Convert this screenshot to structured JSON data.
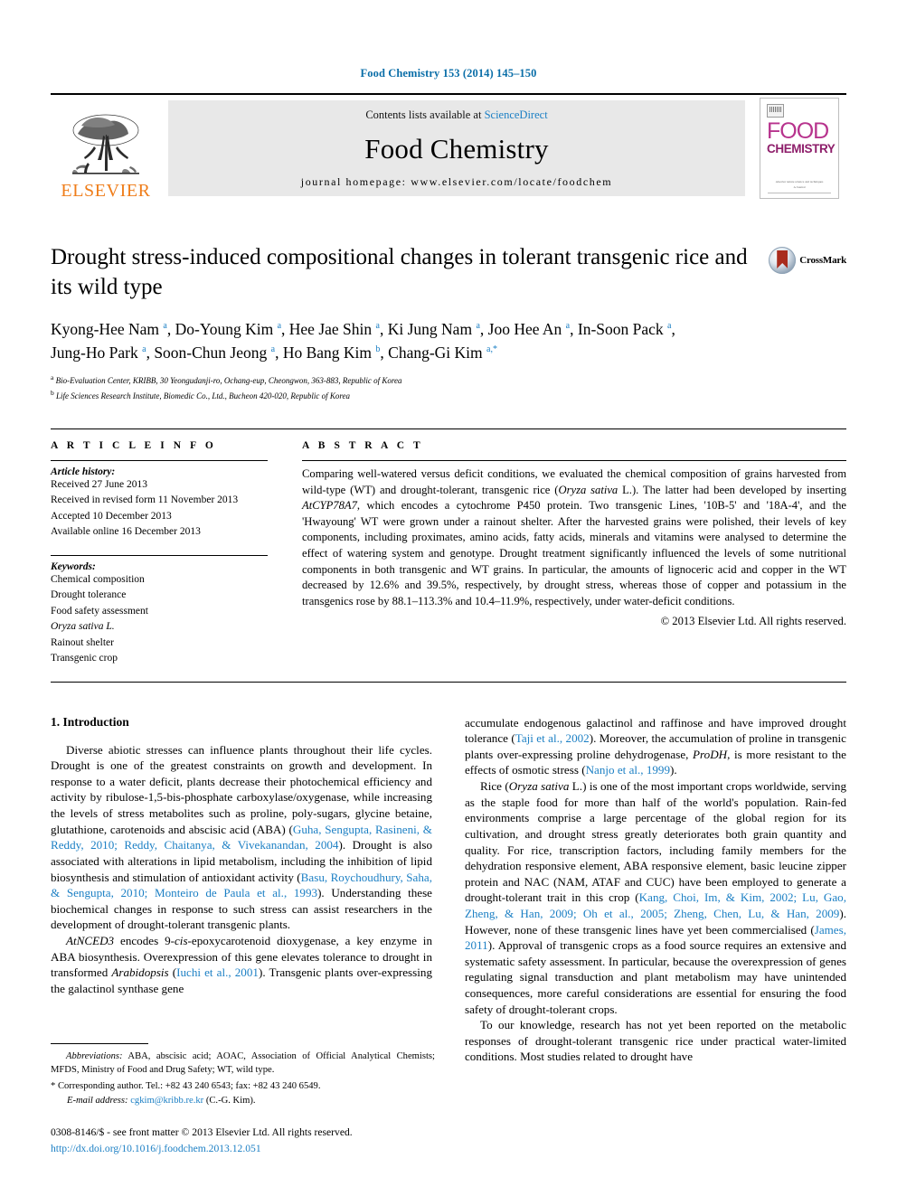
{
  "running_head": "Food Chemistry 153 (2014) 145–150",
  "masthead": {
    "publisher_name": "ELSEVIER",
    "contents_prefix": "Contents lists available at ",
    "contents_link": "ScienceDirect",
    "journal_title": "Food Chemistry",
    "homepage": "journal homepage: www.elsevier.com/locate/foodchem",
    "cover": {
      "food": "FOOD",
      "chemistry": "CHEMISTRY",
      "footer_line1": "Alsevier nature science and techniques",
      "footer_line2": "A Journal"
    }
  },
  "article": {
    "title": "Drought stress-induced compositional changes in tolerant transgenic rice and its wild type",
    "crossmark_label": "CrossMark",
    "authors_line1": "Kyong-Hee Nam a, Do-Young Kim a, Hee Jae Shin a, Ki Jung Nam a, Joo Hee An a, In-Soon Pack a,",
    "authors_line2": "Jung-Ho Park a, Soon-Chun Jeong a, Ho Bang Kim b, Chang-Gi Kim a,*",
    "authors": [
      {
        "name": "Kyong-Hee Nam",
        "sup": "a"
      },
      {
        "name": "Do-Young Kim",
        "sup": "a"
      },
      {
        "name": "Hee Jae Shin",
        "sup": "a"
      },
      {
        "name": "Ki Jung Nam",
        "sup": "a"
      },
      {
        "name": "Joo Hee An",
        "sup": "a"
      },
      {
        "name": "In-Soon Pack",
        "sup": "a"
      },
      {
        "name": "Jung-Ho Park",
        "sup": "a"
      },
      {
        "name": "Soon-Chun Jeong",
        "sup": "a"
      },
      {
        "name": "Ho Bang Kim",
        "sup": "b"
      },
      {
        "name": "Chang-Gi Kim",
        "sup": "a,*"
      }
    ],
    "affiliations": [
      {
        "mark": "a",
        "text": "Bio-Evaluation Center, KRIBB, 30 Yeongudanji-ro, Ochang-eup, Cheongwon, 363-883, Republic of Korea"
      },
      {
        "mark": "b",
        "text": "Life Sciences Research Institute, Biomedic Co., Ltd., Bucheon 420-020, Republic of Korea"
      }
    ]
  },
  "article_info": {
    "heading": "A R T I C L E  I N F O",
    "history_label": "Article history:",
    "history": [
      "Received 27 June 2013",
      "Received in revised form 11 November 2013",
      "Accepted 10 December 2013",
      "Available online 16 December 2013"
    ],
    "keywords_label": "Keywords:",
    "keywords": [
      {
        "text": "Chemical composition",
        "italic": false
      },
      {
        "text": "Drought tolerance",
        "italic": false
      },
      {
        "text": "Food safety assessment",
        "italic": false
      },
      {
        "text": "Oryza sativa L.",
        "italic": true
      },
      {
        "text": "Rainout shelter",
        "italic": false
      },
      {
        "text": "Transgenic crop",
        "italic": false
      }
    ]
  },
  "abstract": {
    "heading": "A B S T R A C T",
    "text_part1": "Comparing well-watered versus deficit conditions, we evaluated the chemical composition of grains harvested from wild-type (WT) and drought-tolerant, transgenic rice (",
    "species_italic": "Oryza sativa",
    "text_part2": " L.). The latter had been developed by inserting ",
    "gene_italic": "AtCYP78A7",
    "text_part3": ", which encodes a cytochrome P450 protein. Two transgenic Lines, '10B-5' and '18A-4', and the 'Hwayoung' WT were grown under a rainout shelter. After the harvested grains were polished, their levels of key components, including proximates, amino acids, fatty acids, minerals and vitamins were analysed to determine the effect of watering system and genotype. Drought treatment significantly influenced the levels of some nutritional components in both transgenic and WT grains. In particular, the amounts of lignoceric acid and copper in the WT decreased by 12.6% and 39.5%, respectively, by drought stress, whereas those of copper and potassium in the transgenics rose by 88.1–113.3% and 10.4–11.9%, respectively, under water-deficit conditions.",
    "copyright": "© 2013 Elsevier Ltd. All rights reserved."
  },
  "introduction": {
    "heading": "1. Introduction",
    "left_paragraphs": [
      {
        "segments": [
          {
            "t": "Diverse abiotic stresses can influence plants throughout their life cycles. Drought is one of the greatest constraints on growth and development. In response to a water deficit, plants decrease their photochemical efficiency and activity by ribulose-1,5-bis-phosphate carboxylase/oxygenase, while increasing the levels of stress metabolites such as proline, poly-sugars, glycine betaine, glutathione, carotenoids and abscisic acid (ABA) ("
          },
          {
            "t": "Guha, Sengupta, Rasineni, & Reddy, 2010; Reddy, Chaitanya, & Vivekanandan, 2004",
            "s": "ref"
          },
          {
            "t": "). Drought is also associated with alterations in lipid metabolism, including the inhibition of lipid biosynthesis and stimulation of antioxidant activity ("
          },
          {
            "t": "Basu, Roychoudhury, Saha, & Sengupta, 2010; Monteiro de Paula et al., 1993",
            "s": "ref"
          },
          {
            "t": "). Understanding these biochemical changes in response to such stress can assist researchers in the development of drought-tolerant transgenic plants."
          }
        ]
      },
      {
        "segments": [
          {
            "t": "AtNCED3",
            "s": "it"
          },
          {
            "t": " encodes 9-"
          },
          {
            "t": "cis",
            "s": "it"
          },
          {
            "t": "-epoxycarotenoid dioxygenase, a key enzyme in ABA biosynthesis. Overexpression of this gene elevates tolerance to drought in transformed "
          },
          {
            "t": "Arabidopsis",
            "s": "it"
          },
          {
            "t": " ("
          },
          {
            "t": "Iuchi et al., 2001",
            "s": "ref"
          },
          {
            "t": "). Transgenic plants over-expressing the galactinol synthase gene"
          }
        ]
      }
    ],
    "right_paragraphs": [
      {
        "segments": [
          {
            "t": "accumulate endogenous galactinol and raffinose and have improved drought tolerance ("
          },
          {
            "t": "Taji et al., 2002",
            "s": "ref"
          },
          {
            "t": "). Moreover, the accumulation of proline in transgenic plants over-expressing proline dehydrogenase, "
          },
          {
            "t": "ProDH",
            "s": "it"
          },
          {
            "t": ", is more resistant to the effects of osmotic stress ("
          },
          {
            "t": "Nanjo et al., 1999",
            "s": "ref"
          },
          {
            "t": ")."
          }
        ]
      },
      {
        "segments": [
          {
            "t": "Rice ("
          },
          {
            "t": "Oryza sativa",
            "s": "it"
          },
          {
            "t": " L.) is one of the most important crops worldwide, serving as the staple food for more than half of the world's population. Rain-fed environments comprise a large percentage of the global region for its cultivation, and drought stress greatly deteriorates both grain quantity and quality. For rice, transcription factors, including family members for the dehydration responsive element, ABA responsive element, basic leucine zipper protein and NAC (NAM, ATAF and CUC) have been employed to generate a drought-tolerant trait in this crop ("
          },
          {
            "t": "Kang, Choi, Im, & Kim, 2002; Lu, Gao, Zheng, & Han, 2009; Oh et al., 2005; Zheng, Chen, Lu, & Han, 2009",
            "s": "ref"
          },
          {
            "t": "). However, none of these transgenic lines have yet been commercialised ("
          },
          {
            "t": "James, 2011",
            "s": "ref"
          },
          {
            "t": "). Approval of transgenic crops as a food source requires an extensive and systematic safety assessment. In particular, because the overexpression of genes regulating signal transduction and plant metabolism may have unintended consequences, more careful considerations are essential for ensuring the food safety of drought-tolerant crops."
          }
        ]
      },
      {
        "segments": [
          {
            "t": "To our knowledge, research has not yet been reported on the metabolic responses of drought-tolerant transgenic rice under practical water-limited conditions. Most studies related to drought have"
          }
        ]
      }
    ]
  },
  "footnotes": {
    "abbreviations_label": "Abbreviations:",
    "abbreviations_text": " ABA, abscisic acid; AOAC, Association of Official Analytical Chemists; MFDS, Ministry of Food and Drug Safety; WT, wild type.",
    "corresponding": "* Corresponding author. Tel.: +82 43 240 6543; fax: +82 43 240 6549.",
    "email_label": "E-mail address:",
    "email": "cgkim@kribb.re.kr",
    "email_suffix": " (C.-G. Kim)."
  },
  "bottom_matter": {
    "issn_line": "0308-8146/$ - see front matter © 2013 Elsevier Ltd. All rights reserved.",
    "doi": "http://dx.doi.org/10.1016/j.foodchem.2013.12.051"
  },
  "colors": {
    "link_blue": "#1b7fc4",
    "running_head_blue": "#0a6ea8",
    "elsevier_orange": "#ef7d1a",
    "cover_magenta": "#b7338d",
    "crossmark_red": "#a92c1e"
  }
}
